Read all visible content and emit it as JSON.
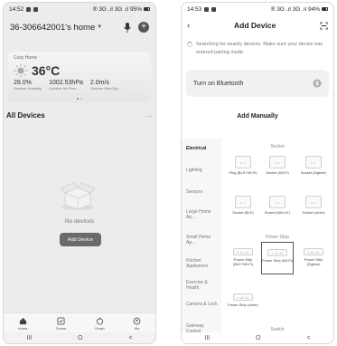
{
  "left": {
    "status": {
      "time": "14:52",
      "signal": "® 3G .ıl 3G .ıl 95%"
    },
    "home_title": "36-306642001's home",
    "weather": {
      "location": "Cozy Home",
      "temp": "36°C",
      "stats": [
        {
          "value": "28.0%",
          "label": "Outdoor Humidity"
        },
        {
          "value": "1002.53hPa",
          "label": "Outdoor Air Pres..."
        },
        {
          "value": "2.0m/s",
          "label": "Outdoor Wind Sp..."
        }
      ]
    },
    "all_devices": "All Devices",
    "more": "...",
    "no_devices": "No devices",
    "add_device_btn": "Add Device",
    "tabs": [
      {
        "label": "Home",
        "icon": "home-icon"
      },
      {
        "label": "Scene",
        "icon": "scene-icon"
      },
      {
        "label": "Smart",
        "icon": "smart-icon"
      },
      {
        "label": "Me",
        "icon": "me-icon"
      }
    ],
    "nav": [
      "III",
      "O",
      "<"
    ]
  },
  "right": {
    "status": {
      "time": "14:53",
      "signal": "® 3G .ıl 3G .ıl 94%"
    },
    "title": "Add Device",
    "search_text": "Searching for nearby devices. Make sure your device has entered pairing mode.",
    "bluetooth": "Turn on Bluetooth",
    "add_manually": "Add Manually",
    "categories": [
      {
        "label": "Electrical",
        "active": true
      },
      {
        "label": "Lighting"
      },
      {
        "label": "Sensors"
      },
      {
        "label": "Large Home Ap..."
      },
      {
        "label": "Small Home Ap..."
      },
      {
        "label": "Kitchen Appliances"
      },
      {
        "label": "Exercise & Health"
      },
      {
        "label": "Camera & Lock"
      },
      {
        "label": "Gateway Control"
      }
    ],
    "sections": [
      "Socket",
      "Power Strip",
      "Switch"
    ],
    "sockets": [
      "Plug (BLE+Wi-Fi)",
      "Socket (Wi-Fi)",
      "Socket (Zigbee)",
      "Socket (BLE)",
      "Socket (NB-IoT)",
      "Socket (other)"
    ],
    "strips": [
      "Power Strip (BLE+Wi-Fi)",
      "Power Strip (Wi-Fi)",
      "Power Strip (Zigbee)",
      "Power Strip (other)"
    ],
    "selected_strip": "Power Strip (Wi-Fi)",
    "nav": [
      "III",
      "O",
      "<"
    ]
  }
}
